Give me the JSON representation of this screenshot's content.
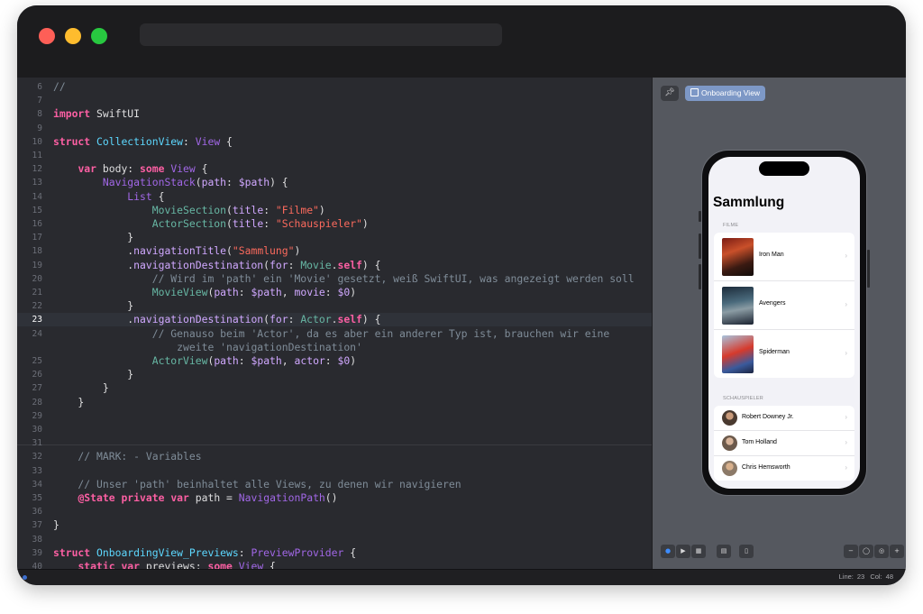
{
  "editor": {
    "lines": [
      {
        "n": "6",
        "segs": [
          [
            "cm",
            "//"
          ]
        ]
      },
      {
        "n": "7",
        "segs": []
      },
      {
        "n": "8",
        "segs": [
          [
            "kw",
            "import"
          ],
          [
            "pl",
            " SwiftUI"
          ]
        ]
      },
      {
        "n": "9",
        "segs": []
      },
      {
        "n": "10",
        "segs": [
          [
            "kw",
            "struct"
          ],
          [
            "pl",
            " "
          ],
          [
            "ty",
            "CollectionView"
          ],
          [
            "pl",
            ": "
          ],
          [
            "lb",
            "View"
          ],
          [
            "pl",
            " {"
          ]
        ]
      },
      {
        "n": "11",
        "segs": []
      },
      {
        "n": "12",
        "segs": [
          [
            "pl",
            "    "
          ],
          [
            "kw",
            "var"
          ],
          [
            "pl",
            " body: "
          ],
          [
            "kw",
            "some"
          ],
          [
            "pl",
            " "
          ],
          [
            "lb",
            "View"
          ],
          [
            "pl",
            " {"
          ]
        ]
      },
      {
        "n": "13",
        "segs": [
          [
            "pl",
            "        "
          ],
          [
            "lb",
            "NavigationStack"
          ],
          [
            "pl",
            "("
          ],
          [
            "sy",
            "path"
          ],
          [
            "pl",
            ": "
          ],
          [
            "sy",
            "$path"
          ],
          [
            "pl",
            ") {"
          ]
        ]
      },
      {
        "n": "14",
        "segs": [
          [
            "pl",
            "            "
          ],
          [
            "lb",
            "List"
          ],
          [
            "pl",
            " {"
          ]
        ]
      },
      {
        "n": "15",
        "segs": [
          [
            "pl",
            "                "
          ],
          [
            "fn",
            "MovieSection"
          ],
          [
            "pl",
            "("
          ],
          [
            "sy",
            "title"
          ],
          [
            "pl",
            ": "
          ],
          [
            "st",
            "\"Filme\""
          ],
          [
            "pl",
            ")"
          ]
        ]
      },
      {
        "n": "16",
        "segs": [
          [
            "pl",
            "                "
          ],
          [
            "fn",
            "ActorSection"
          ],
          [
            "pl",
            "("
          ],
          [
            "sy",
            "title"
          ],
          [
            "pl",
            ": "
          ],
          [
            "st",
            "\"Schauspieler\""
          ],
          [
            "pl",
            ")"
          ]
        ]
      },
      {
        "n": "17",
        "segs": [
          [
            "pl",
            "            }"
          ]
        ]
      },
      {
        "n": "18",
        "segs": [
          [
            "pl",
            "            ."
          ],
          [
            "sy",
            "navigationTitle"
          ],
          [
            "pl",
            "("
          ],
          [
            "st",
            "\"Sammlung\""
          ],
          [
            "pl",
            ")"
          ]
        ]
      },
      {
        "n": "19",
        "segs": [
          [
            "pl",
            "            ."
          ],
          [
            "sy",
            "navigationDestination"
          ],
          [
            "pl",
            "("
          ],
          [
            "sy",
            "for"
          ],
          [
            "pl",
            ": "
          ],
          [
            "fn",
            "Movie"
          ],
          [
            "pl",
            "."
          ],
          [
            "kw",
            "self"
          ],
          [
            "pl",
            ") {"
          ]
        ]
      },
      {
        "n": "20",
        "segs": [
          [
            "cm",
            "                // Wird im 'path' ein 'Movie' gesetzt, weiß SwiftUI, was angezeigt werden soll"
          ]
        ]
      },
      {
        "n": "21",
        "segs": [
          [
            "pl",
            "                "
          ],
          [
            "fn",
            "MovieView"
          ],
          [
            "pl",
            "("
          ],
          [
            "sy",
            "path"
          ],
          [
            "pl",
            ": "
          ],
          [
            "sy",
            "$path"
          ],
          [
            "pl",
            ", "
          ],
          [
            "sy",
            "movie"
          ],
          [
            "pl",
            ": "
          ],
          [
            "sy",
            "$0"
          ],
          [
            "pl",
            ")"
          ]
        ]
      },
      {
        "n": "22",
        "segs": [
          [
            "pl",
            "            }"
          ]
        ]
      },
      {
        "n": "23",
        "current": true,
        "segs": [
          [
            "pl",
            "            ."
          ],
          [
            "sy",
            "navigationDestination"
          ],
          [
            "pl",
            "("
          ],
          [
            "sy",
            "for"
          ],
          [
            "pl",
            ": "
          ],
          [
            "fn",
            "Actor"
          ],
          [
            "pl",
            "."
          ],
          [
            "kw",
            "self"
          ],
          [
            "pl",
            ") {"
          ]
        ]
      },
      {
        "n": "24",
        "segs": [
          [
            "cm",
            "                // Genauso beim 'Actor', da es aber ein anderer Typ ist, brauchen wir eine"
          ]
        ]
      },
      {
        "n": "",
        "segs": [
          [
            "cm",
            "                    zweite 'navigationDestination'"
          ]
        ]
      },
      {
        "n": "25",
        "segs": [
          [
            "pl",
            "                "
          ],
          [
            "fn",
            "ActorView"
          ],
          [
            "pl",
            "("
          ],
          [
            "sy",
            "path"
          ],
          [
            "pl",
            ": "
          ],
          [
            "sy",
            "$path"
          ],
          [
            "pl",
            ", "
          ],
          [
            "sy",
            "actor"
          ],
          [
            "pl",
            ": "
          ],
          [
            "sy",
            "$0"
          ],
          [
            "pl",
            ")"
          ]
        ]
      },
      {
        "n": "26",
        "segs": [
          [
            "pl",
            "            }"
          ]
        ]
      },
      {
        "n": "27",
        "segs": [
          [
            "pl",
            "        }"
          ]
        ]
      },
      {
        "n": "28",
        "segs": [
          [
            "pl",
            "    }"
          ]
        ]
      },
      {
        "n": "29",
        "segs": []
      },
      {
        "n": "30",
        "segs": []
      },
      {
        "n": "31",
        "segs": []
      },
      {
        "n": "32",
        "segs": [
          [
            "cm",
            "    // MARK: - Variables"
          ]
        ]
      },
      {
        "n": "33",
        "segs": []
      },
      {
        "n": "34",
        "segs": [
          [
            "cm",
            "    // Unser 'path' beinhaltet alle Views, zu denen wir navigieren"
          ]
        ]
      },
      {
        "n": "35",
        "segs": [
          [
            "pl",
            "    "
          ],
          [
            "kw",
            "@State"
          ],
          [
            "pl",
            " "
          ],
          [
            "kw",
            "private"
          ],
          [
            "pl",
            " "
          ],
          [
            "kw",
            "var"
          ],
          [
            "pl",
            " path = "
          ],
          [
            "lb",
            "NavigationPath"
          ],
          [
            "pl",
            "()"
          ]
        ]
      },
      {
        "n": "36",
        "segs": []
      },
      {
        "n": "37",
        "segs": [
          [
            "pl",
            "}"
          ]
        ]
      },
      {
        "n": "38",
        "segs": []
      },
      {
        "n": "39",
        "segs": [
          [
            "kw",
            "struct"
          ],
          [
            "pl",
            " "
          ],
          [
            "ty",
            "OnboardingView_Previews"
          ],
          [
            "pl",
            ": "
          ],
          [
            "lb",
            "PreviewProvider"
          ],
          [
            "pl",
            " {"
          ]
        ]
      },
      {
        "n": "40",
        "segs": [
          [
            "pl",
            "    "
          ],
          [
            "kw",
            "static"
          ],
          [
            "pl",
            " "
          ],
          [
            "kw",
            "var"
          ],
          [
            "pl",
            " previews: "
          ],
          [
            "kw",
            "some"
          ],
          [
            "pl",
            " "
          ],
          [
            "lb",
            "View"
          ],
          [
            "pl",
            " {"
          ]
        ]
      }
    ]
  },
  "canvas": {
    "chip_label": "Onboarding View",
    "pin_icon": "pin-icon"
  },
  "preview": {
    "nav_title": "Sammlung",
    "sections": [
      {
        "header": "FILME",
        "kind": "movie",
        "rows": [
          {
            "label": "Iron Man",
            "art": "p-ironman"
          },
          {
            "label": "Avengers",
            "art": "p-avengers"
          },
          {
            "label": "Spiderman",
            "art": "p-spiderman"
          }
        ]
      },
      {
        "header": "SCHAUSPIELER",
        "kind": "actor",
        "rows": [
          {
            "label": "Robert Downey Jr.",
            "art": "a1"
          },
          {
            "label": "Tom Holland",
            "art": "a2"
          },
          {
            "label": "Chris Hemsworth",
            "art": "a3"
          }
        ]
      }
    ]
  },
  "status": {
    "line_label": "Line:",
    "line_value": "23",
    "col_label": "Col:",
    "col_value": "48"
  }
}
